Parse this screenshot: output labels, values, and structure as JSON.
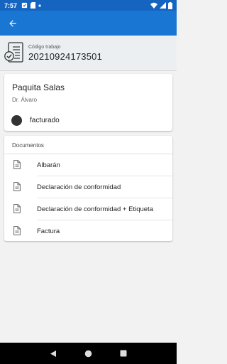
{
  "status_bar": {
    "time": "7:57",
    "left_icons": [
      "notification-icon",
      "sd-card-icon",
      "dot-icon"
    ],
    "right_icons": [
      "wifi-icon",
      "signal-icon",
      "battery-icon"
    ]
  },
  "app_bar": {
    "back_icon": "arrow-back-icon"
  },
  "work_code": {
    "label": "Código trabajo",
    "value": "20210924173501"
  },
  "client": {
    "name": "Paquita Salas",
    "subtitle": "Dr. Álvaro",
    "status_label": "facturado",
    "status_color": "#333333"
  },
  "documents": {
    "title": "Documentos",
    "items": [
      {
        "label": "Albarán"
      },
      {
        "label": "Declaración de conformidad"
      },
      {
        "label": "Declaración de conformidad + Etiqueta"
      },
      {
        "label": "Factura"
      }
    ]
  },
  "colors": {
    "status_bar": "#1565c0",
    "app_bar": "#1976d2",
    "background": "#f2f2f2"
  }
}
